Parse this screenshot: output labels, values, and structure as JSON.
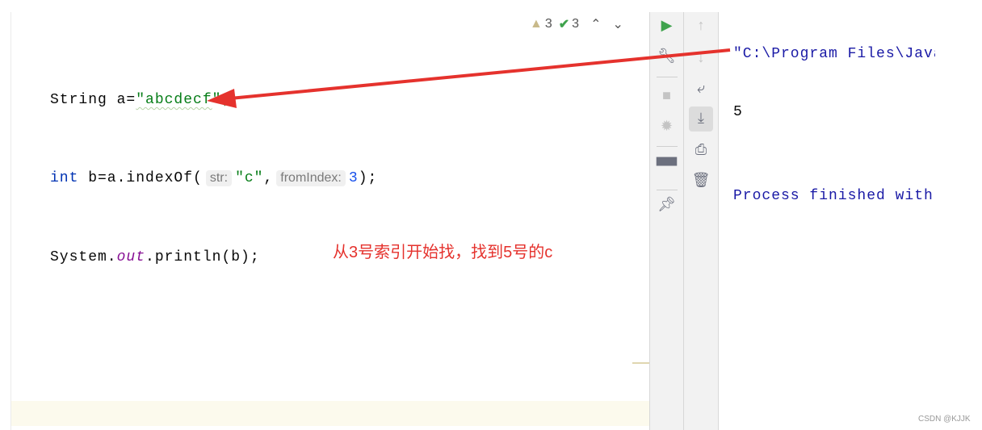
{
  "inspection": {
    "warnings": "3",
    "typos": "3"
  },
  "code": {
    "line1": {
      "type": "String",
      "rest": " a=",
      "string": "\"abcdecf",
      "tail": "\";"
    },
    "line2": {
      "kw": "int",
      "pre": " b=a.indexOf(",
      "hint1": "str:",
      "arg1": "\"c\"",
      "comma": ",",
      "hint2": "fromIndex:",
      "arg2": "3",
      "end": ");"
    },
    "line3": {
      "pre": "System.",
      "field": "out",
      "post": ".println(b);"
    }
  },
  "annotation": "从3号索引开始找，找到5号的c",
  "console": {
    "command": "\"C:\\Program Files\\Java",
    "output": "5",
    "finished": "Process finished with"
  },
  "watermark": "CSDN @KJJK",
  "colors": {
    "arrow": "#e5322d",
    "run": "#3fa34d"
  }
}
